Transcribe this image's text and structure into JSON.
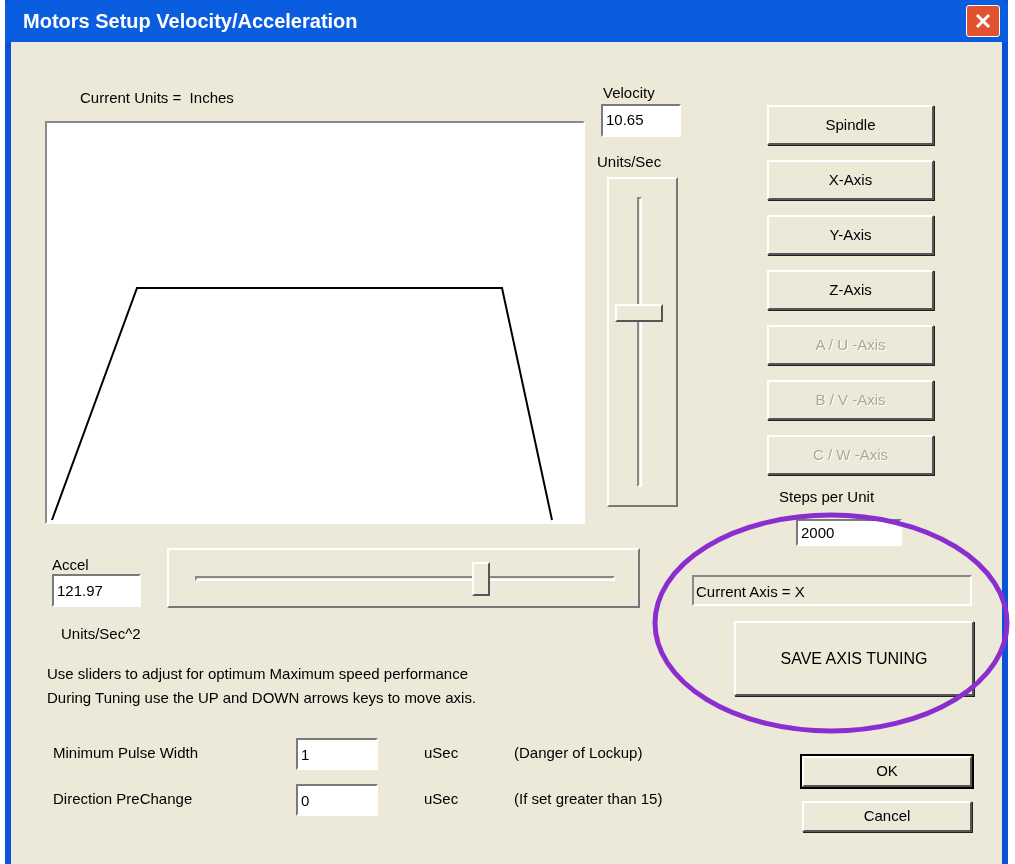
{
  "window": {
    "title": "Motors Setup Velocity/Acceleration"
  },
  "units_label": "Current Units =  Inches",
  "velocity": {
    "label": "Velocity",
    "value": "10.65",
    "unit": "Units/Sec",
    "level": 0.6
  },
  "axis_buttons": [
    {
      "label": "Spindle",
      "disabled": false
    },
    {
      "label": "X-Axis",
      "disabled": false
    },
    {
      "label": "Y-Axis",
      "disabled": false
    },
    {
      "label": "Z-Axis",
      "disabled": false
    },
    {
      "label": "A / U -Axis",
      "disabled": true
    },
    {
      "label": "B / V -Axis",
      "disabled": true
    },
    {
      "label": "C / W -Axis",
      "disabled": true
    }
  ],
  "steps_per_unit": {
    "label": "Steps per Unit",
    "value": "2000"
  },
  "accel": {
    "label": "Accel",
    "value": "121.97",
    "unit": "Units/Sec^2",
    "level": 0.68
  },
  "current_axis": "Current Axis = X",
  "save_button": "SAVE AXIS TUNING",
  "instructions": [
    "Use sliders to adjust for optimum Maximum speed performance",
    "During Tuning use the UP and DOWN arrows keys to move axis."
  ],
  "settings": [
    {
      "label": "Minimum Pulse Width",
      "value": "1",
      "unit": "uSec",
      "note": "(Danger of Lockup)"
    },
    {
      "label": "Direction PreChange",
      "value": "0",
      "unit": "uSec",
      "note": "(If set greater than 15)"
    }
  ],
  "buttons": [
    {
      "label": "OK",
      "default": true
    },
    {
      "label": "Cancel",
      "default": false
    }
  ],
  "annotation": {
    "kind": "ellipse"
  }
}
